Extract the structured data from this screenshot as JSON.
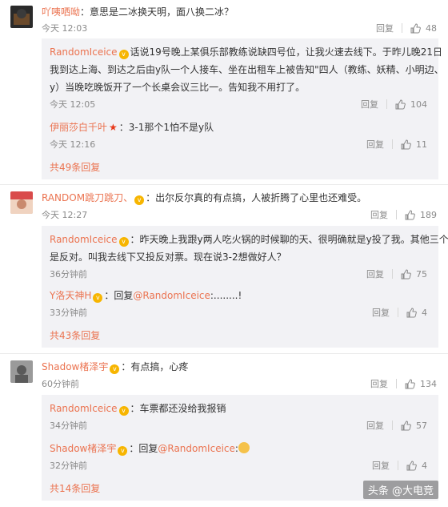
{
  "threads": [
    {
      "name": "吖咦哂呦",
      "text": "：意思是二冰换天明，面八换二冰？",
      "time": "今天 12:03",
      "reply_label": "回复",
      "likes": "48",
      "avatar_colors": [
        "#2a2a2a",
        "#6b4a2b"
      ],
      "replies": [
        {
          "name": "RandomIceice",
          "text1": "话说19号晚上某俱乐部教练说缺四号位，让我火速去线下。于昨儿晚21日",
          "text2": "我到达上海、到达之后由y队一个人接车、坐在出租车上被告知\"四人（教练、妖精、小明边、",
          "text3": "y）当晚吃晚饭开了一个长桌会议三比一。告知我不用打了。",
          "time": "今天 12:05",
          "reply_label": "回复",
          "likes": "104"
        },
        {
          "name": "伊丽莎白千叶",
          "text1": "：3-1那个1怕不是y队",
          "time": "今天 12:16",
          "reply_label": "回复",
          "likes": "11"
        }
      ],
      "more": "共49条回复"
    },
    {
      "name": "RANDOM跳刀跳刀、",
      "text": "：出尔反尔真的有点搞，人被折腾了心里也还难受。",
      "time": "今天 12:27",
      "reply_label": "回复",
      "likes": "189",
      "avatar_colors": [
        "#d94b4b",
        "#f0d3c0"
      ],
      "replies": [
        {
          "name": "RandomIceice",
          "text1": "：昨天晚上我跟y两人吃火锅的时候聊的天、很明确就是y投了我。其他三个",
          "text2": "是反对。叫我去线下又投反对票。现在说3-2想做好人？",
          "time": "36分钟前",
          "reply_label": "回复",
          "likes": "75"
        },
        {
          "name": "Y洛天神H",
          "text1": "：回复",
          "mention": "@RandomIceice",
          "tail": ":........!",
          "time": "33分钟前",
          "reply_label": "回复",
          "likes": "4"
        }
      ],
      "more": "共43条回复"
    },
    {
      "name": "Shadow楮泽宇",
      "text": "：有点搞，心疼",
      "time": "60分钟前",
      "reply_label": "回复",
      "likes": "134",
      "avatar_colors": [
        "#9a9a9a",
        "#5a5a5a"
      ],
      "replies": [
        {
          "name": "RandomIceice",
          "text1": "：车票都还没给我报销",
          "time": "34分钟前",
          "reply_label": "回复",
          "likes": "57"
        },
        {
          "name": "Shadow楮泽宇",
          "text1": "：回复",
          "mention": "@RandomIceice",
          "tail": ":",
          "time": "32分钟前",
          "reply_label": "回复",
          "likes": "4"
        }
      ],
      "more": "共14条回复"
    }
  ],
  "watermark": "头条 @大电竞",
  "icons": {
    "like": "thumbs-up-icon",
    "vip": "vip-badge-icon",
    "star": "star-icon",
    "emoji": "laughing-emoji-icon"
  }
}
